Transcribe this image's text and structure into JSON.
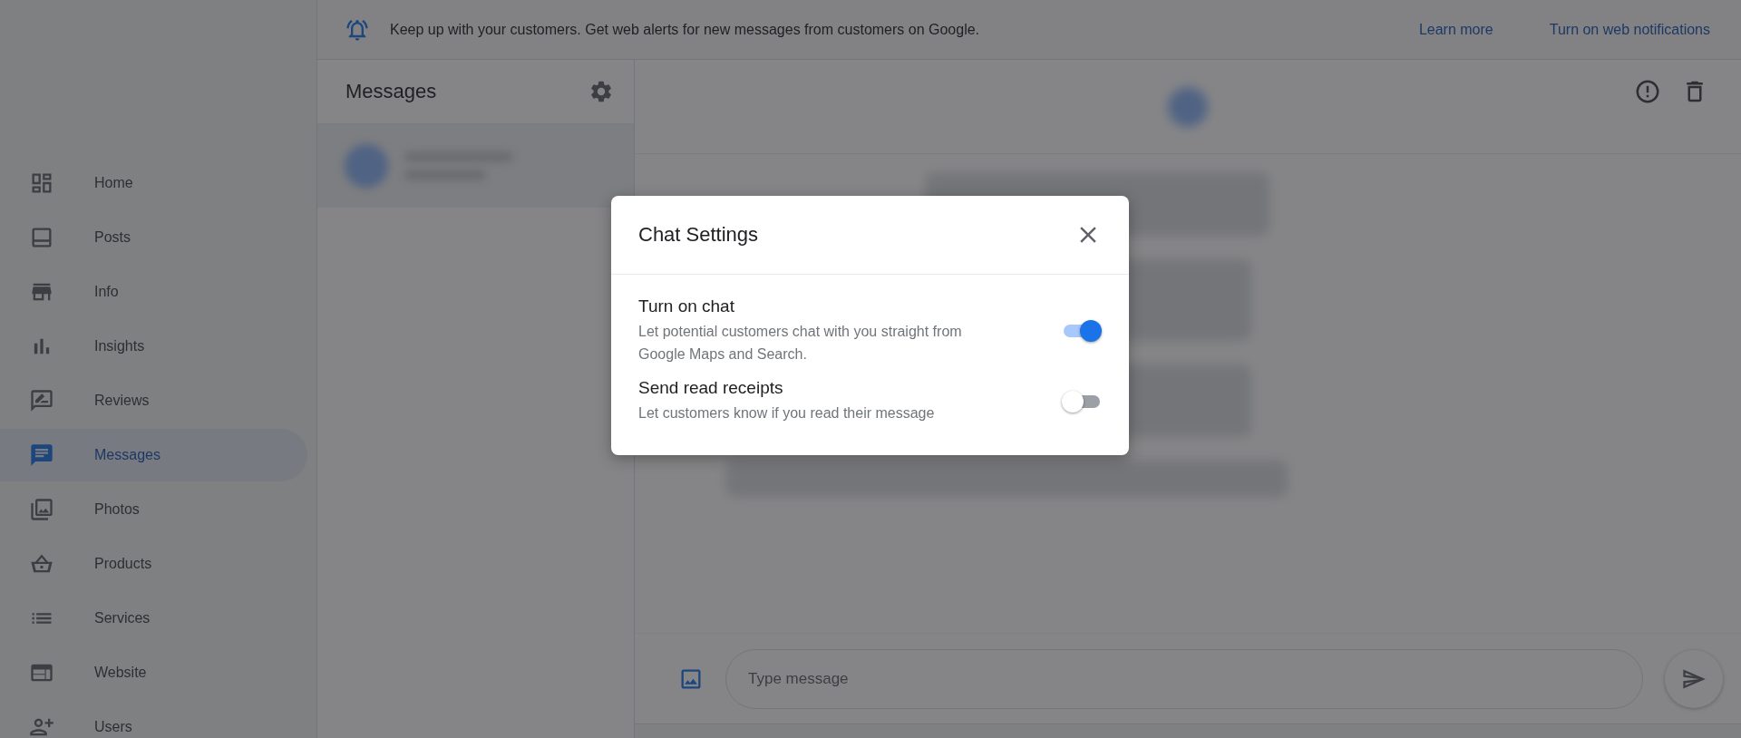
{
  "banner": {
    "text": "Keep up with your customers. Get web alerts for new messages from customers on Google.",
    "links": [
      "Learn more",
      "Turn on web notifications"
    ]
  },
  "sidebar": {
    "items": [
      {
        "label": "Home",
        "kind": "dashboard",
        "selected": false
      },
      {
        "label": "Posts",
        "kind": "posts",
        "selected": false
      },
      {
        "label": "Info",
        "kind": "store",
        "selected": false
      },
      {
        "label": "Insights",
        "kind": "bars",
        "selected": false
      },
      {
        "label": "Reviews",
        "kind": "review",
        "selected": false
      },
      {
        "label": "Messages",
        "kind": "chat",
        "selected": true
      },
      {
        "label": "Photos",
        "kind": "photos",
        "selected": false
      },
      {
        "label": "Products",
        "kind": "basket",
        "selected": false
      },
      {
        "label": "Services",
        "kind": "list",
        "selected": false
      },
      {
        "label": "Website",
        "kind": "web",
        "selected": false
      },
      {
        "label": "Users",
        "kind": "person",
        "selected": false
      }
    ]
  },
  "messages_panel": {
    "title": "Messages"
  },
  "compose": {
    "placeholder": "Type message"
  },
  "dialog": {
    "title": "Chat Settings",
    "settings": [
      {
        "title": "Turn on chat",
        "description": "Let potential customers chat with you straight from Google Maps and Search.",
        "on": true
      },
      {
        "title": "Send read receipts",
        "description": "Let customers know if you read their message",
        "on": false
      }
    ]
  }
}
